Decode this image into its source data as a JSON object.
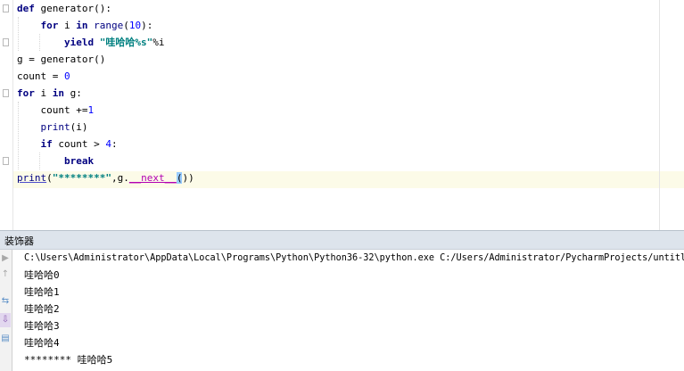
{
  "editor": {
    "lines": [
      {
        "tokens": [
          {
            "t": "def",
            "c": "kw"
          },
          {
            "t": " generator():",
            "c": ""
          }
        ]
      },
      {
        "tokens": [
          {
            "t": "    ",
            "c": ""
          },
          {
            "t": "for",
            "c": "kw"
          },
          {
            "t": " i ",
            "c": ""
          },
          {
            "t": "in",
            "c": "kw"
          },
          {
            "t": " ",
            "c": ""
          },
          {
            "t": "range",
            "c": "fn"
          },
          {
            "t": "(",
            "c": ""
          },
          {
            "t": "10",
            "c": "num"
          },
          {
            "t": "):",
            "c": ""
          }
        ]
      },
      {
        "tokens": [
          {
            "t": "        ",
            "c": ""
          },
          {
            "t": "yield",
            "c": "kw"
          },
          {
            "t": " ",
            "c": ""
          },
          {
            "t": "\"哇哈哈%s\"",
            "c": "str"
          },
          {
            "t": "%i",
            "c": ""
          }
        ]
      },
      {
        "tokens": [
          {
            "t": "g = generator()",
            "c": ""
          }
        ]
      },
      {
        "tokens": [
          {
            "t": "count = ",
            "c": ""
          },
          {
            "t": "0",
            "c": "num"
          }
        ]
      },
      {
        "tokens": [
          {
            "t": "for",
            "c": "kw"
          },
          {
            "t": " i ",
            "c": ""
          },
          {
            "t": "in",
            "c": "kw"
          },
          {
            "t": " g:",
            "c": ""
          }
        ]
      },
      {
        "tokens": [
          {
            "t": "    count +=",
            "c": ""
          },
          {
            "t": "1",
            "c": "num"
          }
        ]
      },
      {
        "tokens": [
          {
            "t": "    ",
            "c": ""
          },
          {
            "t": "print",
            "c": "fn"
          },
          {
            "t": "(i)",
            "c": ""
          }
        ]
      },
      {
        "tokens": [
          {
            "t": "    ",
            "c": ""
          },
          {
            "t": "if",
            "c": "kw"
          },
          {
            "t": " count > ",
            "c": ""
          },
          {
            "t": "4",
            "c": "num"
          },
          {
            "t": ":",
            "c": ""
          }
        ]
      },
      {
        "tokens": [
          {
            "t": "        ",
            "c": ""
          },
          {
            "t": "break",
            "c": "kw"
          }
        ]
      },
      {
        "tokens": [
          {
            "t": "print",
            "c": "fn ul"
          },
          {
            "t": "(",
            "c": ""
          },
          {
            "t": "\"********\"",
            "c": "str"
          },
          {
            "t": ",g.",
            "c": ""
          },
          {
            "t": "__next__",
            "c": "magic"
          },
          {
            "t": "(",
            "c": "paren-hl"
          },
          {
            "t": ")",
            "c": ""
          },
          {
            "t": ")",
            "c": ""
          }
        ]
      }
    ]
  },
  "run_panel": {
    "title": "装饰器",
    "output": [
      "C:\\Users\\Administrator\\AppData\\Local\\Programs\\Python\\Python36-32\\python.exe C:/Users/Administrator/PycharmProjects/untitled/",
      "哇哈哈0",
      "哇哈哈1",
      "哇哈哈2",
      "哇哈哈3",
      "哇哈哈4",
      "******** 哇哈哈5"
    ]
  },
  "toolbar": {
    "icons": [
      "rerun-icon",
      "stop-icon",
      "soft-wrap-icon",
      "scroll-to-end-icon",
      "print-icon"
    ]
  },
  "colors": {
    "keyword": "#000080",
    "number": "#0000ff",
    "string": "#008080",
    "magic_method": "#b200b2",
    "current_line_bg": "#fcfbe8",
    "run_header_bg": "#dde4ec"
  }
}
